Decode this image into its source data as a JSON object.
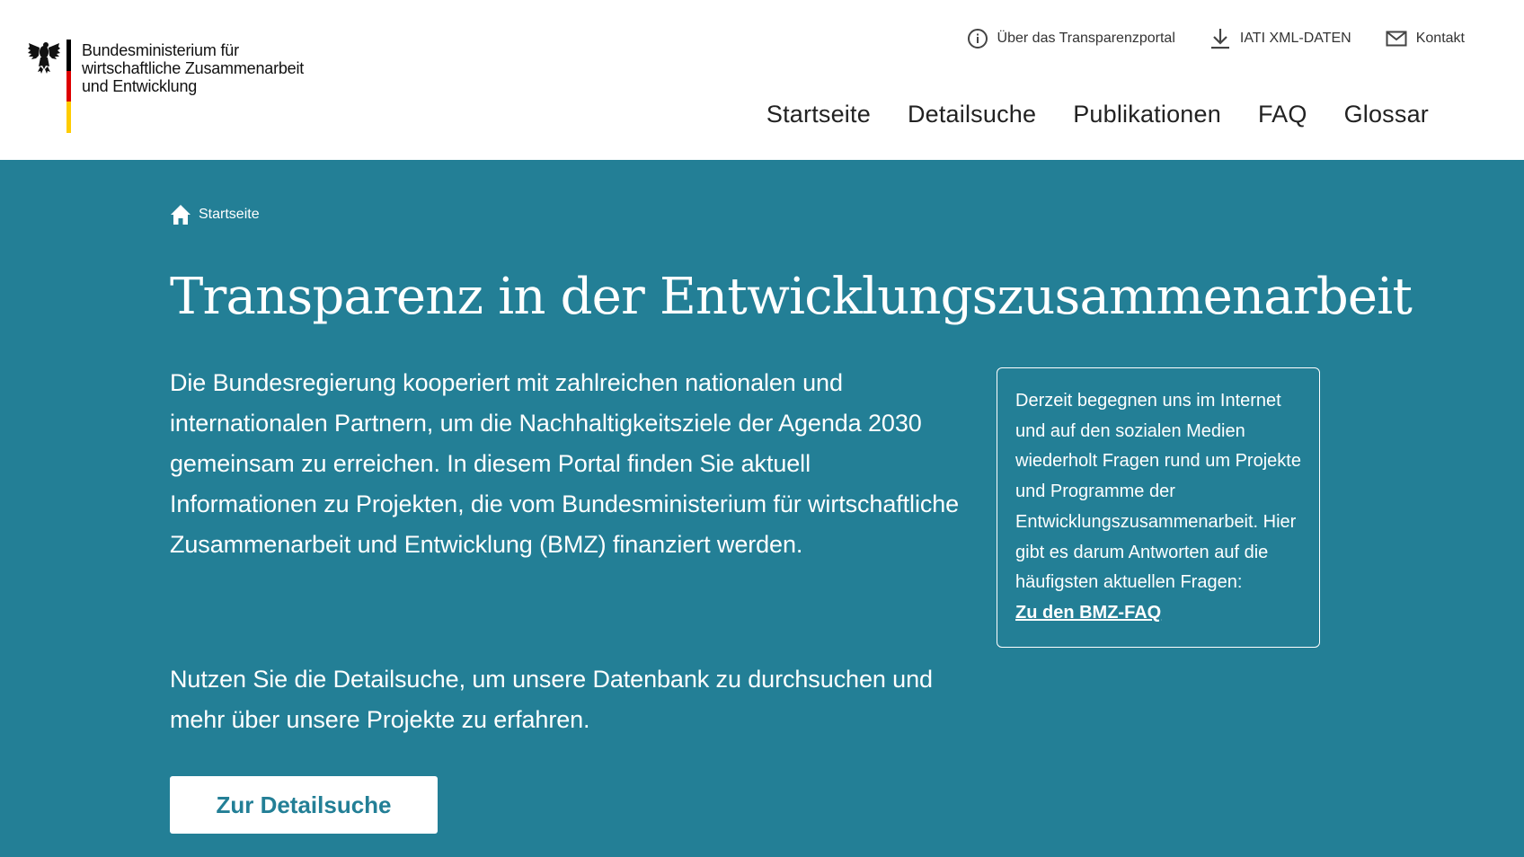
{
  "header": {
    "logo": {
      "line1": "Bundesministerium für",
      "line2": "wirtschaftliche Zusammenarbeit",
      "line3": "und Entwicklung"
    },
    "service_nav": [
      {
        "label": "Über das Transparenzportal",
        "icon": "info-icon"
      },
      {
        "label": "IATI XML-DATEN",
        "icon": "download-icon"
      },
      {
        "label": "Kontakt",
        "icon": "mail-icon"
      }
    ],
    "main_nav": [
      "Startseite",
      "Detailsuche",
      "Publikationen",
      "FAQ",
      "Glossar"
    ]
  },
  "hero": {
    "breadcrumb": {
      "label": "Startseite",
      "icon": "home-icon"
    },
    "title": "Transparenz in der Entwicklungszusammenarbeit",
    "intro": "Die Bundesregierung kooperiert mit zahlreichen nationalen und internationalen Partnern, um die Nachhaltigkeitsziele der Agenda 2030 gemeinsam zu erreichen. In diesem Portal finden Sie aktuell Informationen zu Projekten, die vom Bundesministerium für wirtschaftliche Zusammenarbeit und Entwicklung (BMZ) finanziert werden.",
    "intro2": "Nutzen Sie die Detailsuche, um unsere Datenbank zu durchsuchen und mehr über unsere Projekte zu erfahren.",
    "cta_label": "Zur Detailsuche",
    "info_box": {
      "text": "Derzeit begegnen uns im Internet und auf den sozialen Medien wiederholt Fragen rund um Projekte und Programme der Entwicklungszusammenarbeit. Hier gibt es darum Antworten auf die häufigsten aktuellen Fragen:",
      "link_label": "Zu den BMZ-FAQ"
    }
  },
  "colors": {
    "hero_background": "#237f96",
    "header_background": "#ffffff",
    "flag_black": "#000000",
    "flag_red": "#dd0000",
    "flag_gold": "#ffcc00"
  }
}
